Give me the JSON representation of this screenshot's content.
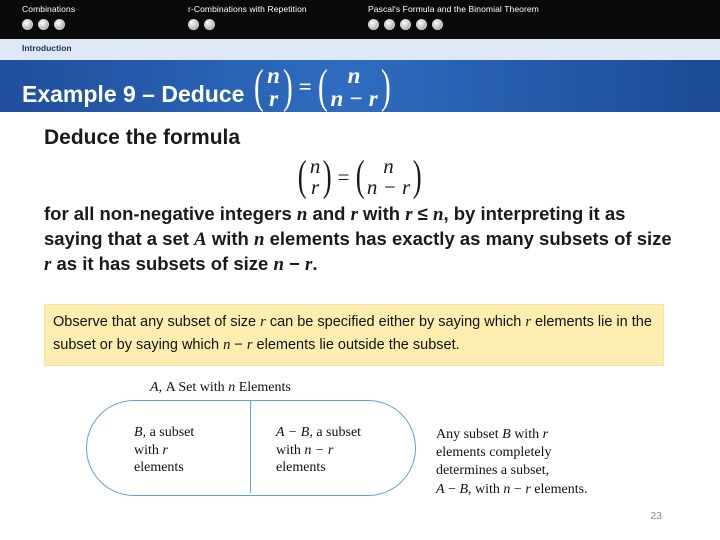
{
  "topnav": {
    "sections": [
      {
        "title": "Combinations",
        "dots": 3,
        "filled": [
          false,
          false,
          false
        ]
      },
      {
        "title": "r-Combinations with Repetition",
        "dots": 2,
        "filled": [
          false,
          false
        ]
      },
      {
        "title": "Pascal's Formula and the Binomial Theorem",
        "dots": 5,
        "filled": [
          true,
          false,
          false,
          false,
          false
        ]
      }
    ]
  },
  "breadcrumb": {
    "label": "Introduction"
  },
  "title": {
    "prefix": "Example 9 – Deduce",
    "equation": {
      "lhs_top": "n",
      "lhs_bottom": "r",
      "eq": "=",
      "rhs_top": "n",
      "rhs_bottom": "n − r"
    }
  },
  "content": {
    "deduce_heading": "Deduce the formula",
    "center_equation": {
      "lhs_top": "n",
      "lhs_bottom": "r",
      "eq": "=",
      "rhs_top": "n",
      "rhs_bottom": "n − r"
    },
    "paragraph_html": "for all non-negative integers <i>n</i> and <i>r</i> with <i>r</i> ≤ <i>n</i>, by interpreting it as saying that a set <i>A</i> with <i>n</i> elements has exactly as many subsets of size <i>r</i> as it has subsets of size <i>n</i> − <i>r</i>.",
    "callout_html": "Observe that any subset of size <i>r</i> can be specified either by saying which <i>r</i> elements lie in the subset or by saying which <i>n</i> − <i>r</i> elements lie outside the subset."
  },
  "diagram": {
    "caption_html": "<i>A</i>, <span class=\"up\">A Set with</span> <i>n</i> <span class=\"up\">Elements</span>",
    "left_cell_html": "<i>B</i>, <span class=\"up\">a subset</span><br><span class=\"up\">with</span> <i>r</i><br><span class=\"up\">elements</span>",
    "right_cell_html": "<i>A</i> − <i>B</i>, <span class=\"up\">a subset</span><br><span class=\"up\">with</span> <i>n</i> − <i>r</i><br><span class=\"up\">elements</span>",
    "note_html": "Any subset <i>B</i> with <i>r</i><br>elements completely<br>determines a subset,<br><i>A</i> − <i>B</i>, with <i>n</i> − <i>r</i> elements.",
    "border_color": "#5aa7d8"
  },
  "page_number": "23",
  "colors": {
    "topbar": "#0a0a0a",
    "intro_band": "#dfe9f5",
    "intro_text": "#17375e",
    "title_band": "#2f6cc0",
    "callout_bg": "#fdeeb0"
  }
}
